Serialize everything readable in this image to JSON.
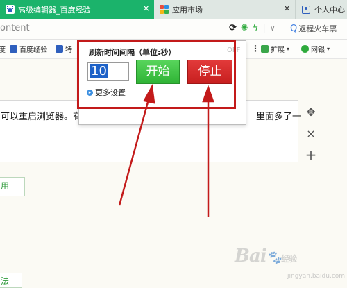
{
  "tabs": [
    {
      "label": "高级编辑器_百度经验",
      "active": true
    },
    {
      "label": "应用市场",
      "active": false
    },
    {
      "label": "个人中心",
      "active": false
    }
  ],
  "tab_close_glyph": "×",
  "address": {
    "url_fragment": "ontent",
    "search_text": "返程火车票"
  },
  "bookmarks": [
    {
      "label": "度"
    },
    {
      "label": "百度经验"
    },
    {
      "label": "特"
    },
    {
      "label": "扩展"
    },
    {
      "label": "网银"
    }
  ],
  "popup": {
    "title": "刷新时间间隔（单位:秒）",
    "interval_value": "10",
    "start_label": "开始",
    "stop_label": "停止",
    "more_settings": "更多设置",
    "off_text": "OFF"
  },
  "content": {
    "text_left": "可以重启浏览器。有",
    "text_right": "里面多了一",
    "button_1": "用",
    "button_2": "法"
  },
  "side_tools": [
    "✥",
    "×",
    "+"
  ],
  "watermark": {
    "brand": "Bai",
    "brand2": "经验",
    "sub": "jingyan.baidu.com"
  },
  "colors": {
    "tab_active": "#1bb36b",
    "start_button": "#3cc240",
    "stop_button": "#d42a2a",
    "annotation_red": "#c31a1a"
  }
}
